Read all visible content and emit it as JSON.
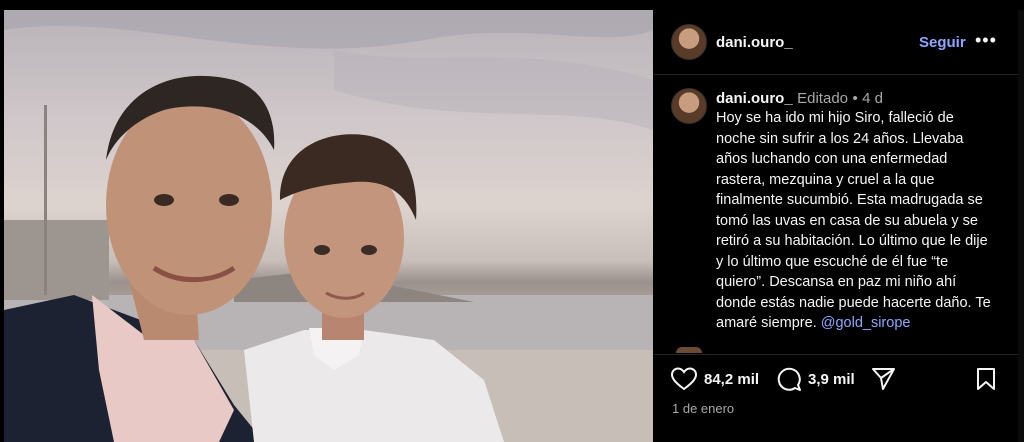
{
  "header": {
    "username": "dani.ouro_",
    "follow_label": "Seguir",
    "more_label": "•••",
    "avatar_icon": "profile-avatar-icon"
  },
  "caption": {
    "username": "dani.ouro_",
    "edited": "Editado",
    "separator": "•",
    "age": "4 d",
    "text": "Hoy se ha ido mi hijo Siro, falleció de noche sin sufrir a los 24 años. Llevaba años luchando con una enfermedad rastera, mezquina y cruel a la que finalmente sucumbió. Esta madrugada se tomó las uvas en casa de su abuela y se retiró a su habitación. Lo último que le dije y lo último que escuché de él fue “te quiero”. Descansa en paz mi niño ahí donde estás nadie puede hacerte daño. Te amaré siempre. ",
    "mention": "@gold_sirope"
  },
  "actions": {
    "likes": "84,2 mil",
    "comments": "3,9 mil",
    "like_icon": "heart-icon",
    "comment_icon": "comment-bubble-icon",
    "share_icon": "share-icon",
    "save_icon": "bookmark-icon"
  },
  "date": "1 de enero",
  "colors": {
    "background": "#000000",
    "link": "#8fa6ff",
    "muted": "#a8a8a8"
  }
}
